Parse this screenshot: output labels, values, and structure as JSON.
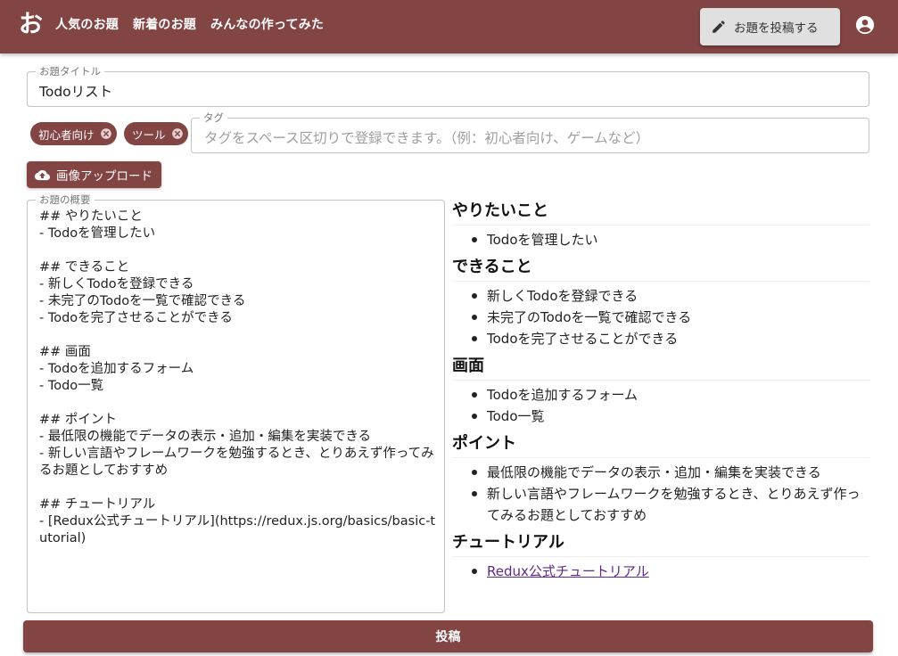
{
  "header": {
    "logo_icon": "hiragana-o-logo-icon",
    "nav": [
      "人気のお題",
      "新着のお題",
      "みんなの作ってみた"
    ],
    "post_topic_label": "お題を投稿する",
    "colors": {
      "brand": "#834444"
    }
  },
  "form": {
    "title_label": "お題タイトル",
    "title_value": "Todoリスト",
    "tags": [
      "初心者向け",
      "ツール"
    ],
    "tag_label": "タグ",
    "tag_placeholder": "タグをスペース区切りで登録できます。（例：初心者向け、ゲームなど）",
    "upload_label": "画像アップロード",
    "overview_label": "お題の概要",
    "overview_value": "## やりたいこと\n- Todoを管理したい\n\n## できること\n- 新しくTodoを登録できる\n- 未完了のTodoを一覧で確認できる\n- Todoを完了させることができる\n\n## 画面\n- Todoを追加するフォーム\n- Todo一覧\n\n## ポイント\n- 最低限の機能でデータの表示・追加・編集を実装できる\n- 新しい言語やフレームワークを勉強するとき、とりあえず作ってみるお題としておすすめ\n\n## チュートリアル\n- [Redux公式チュートリアル](https://redux.js.org/basics/basic-tutorial)",
    "submit_label": "投稿"
  },
  "preview": {
    "sections": [
      {
        "heading": "やりたいこと",
        "items": [
          "Todoを管理したい"
        ]
      },
      {
        "heading": "できること",
        "items": [
          "新しくTodoを登録できる",
          "未完了のTodoを一覧で確認できる",
          "Todoを完了させることができる"
        ]
      },
      {
        "heading": "画面",
        "items": [
          "Todoを追加するフォーム",
          "Todo一覧"
        ]
      },
      {
        "heading": "ポイント",
        "items": [
          "最低限の機能でデータの表示・追加・編集を実装できる",
          "新しい言語やフレームワークを勉強するとき、とりあえず作ってみるお題としておすすめ"
        ]
      },
      {
        "heading": "チュートリアル",
        "links": [
          "Redux公式チュートリアル"
        ]
      }
    ]
  }
}
